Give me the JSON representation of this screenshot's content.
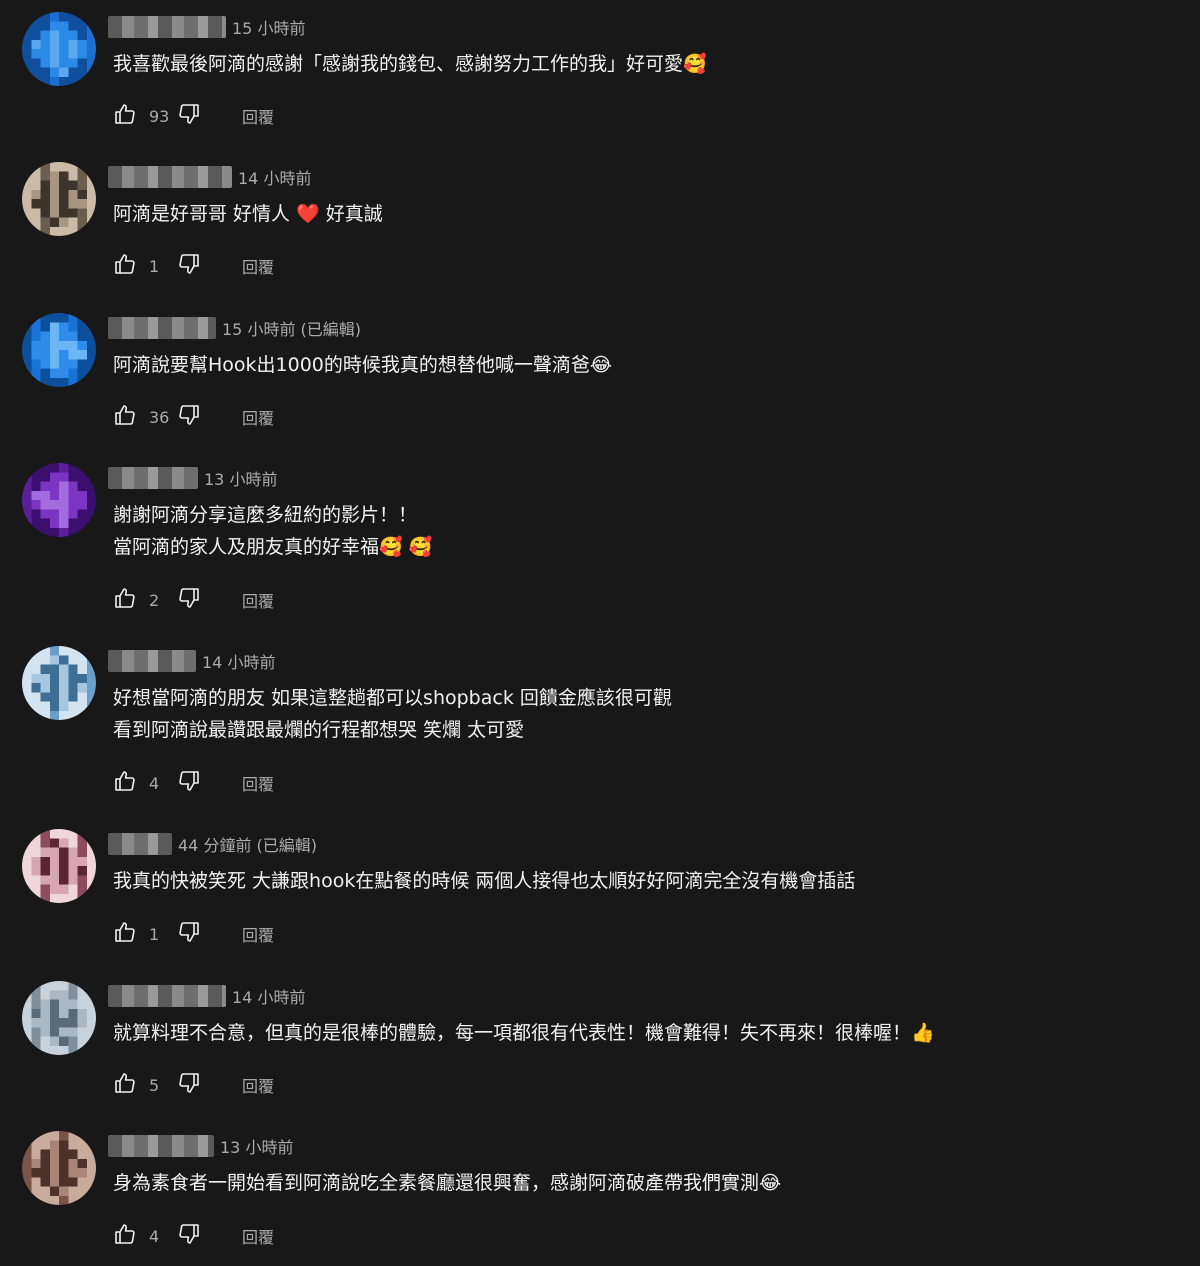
{
  "ui": {
    "reply_label": "回覆"
  },
  "comments": [
    {
      "time": "15 小時前",
      "text_lines": [
        "我喜歡最後阿滴的感謝「感謝我的錢包、感謝努力工作的我」好可愛🥰"
      ],
      "likes": "93",
      "avatar_colors": [
        "#1a6fd1",
        "#2b8ae6",
        "#5aa8f0",
        "#0f4f9e"
      ]
    },
    {
      "time": "14 小時前",
      "text_lines": [
        "阿滴是好哥哥 好情人 ❤️ 好真誠"
      ],
      "likes": "1",
      "avatar_colors": [
        "#6b5e4e",
        "#a89680",
        "#3d342c",
        "#cbbba6"
      ]
    },
    {
      "time": "15 小時前 (已編輯)",
      "text_lines": [
        "阿滴說要幫Hook出1000的時候我真的想替他喊一聲滴爸😂"
      ],
      "likes": "36",
      "avatar_colors": [
        "#1773d6",
        "#2f8cea",
        "#6cb6f5",
        "#0c4f9a"
      ]
    },
    {
      "time": "13 小時前",
      "text_lines": [
        "謝謝阿滴分享這麼多紐約的影片！！",
        "當阿滴的家人及朋友真的好幸福🥰 🥰"
      ],
      "likes": "2",
      "avatar_colors": [
        "#5b1f9c",
        "#7a35c2",
        "#a36be0",
        "#3a0f6e"
      ]
    },
    {
      "time": "14 小時前",
      "text_lines": [
        "好想當阿滴的朋友 如果這整趟都可以shopback 回饋金應該很可觀",
        "看到阿滴說最讚跟最爛的行程都想哭 笑爛 太可愛"
      ],
      "likes": "4",
      "avatar_colors": [
        "#6a9fc9",
        "#a7c7e0",
        "#3d6f96",
        "#d3e3ef"
      ]
    },
    {
      "time": "44 分鐘前 (已編輯)",
      "text_lines": [
        "我真的快被笑死 大謙跟hook在點餐的時候 兩個人接得也太順好好阿滴完全沒有機會插話"
      ],
      "likes": "1",
      "avatar_colors": [
        "#8e4b5f",
        "#d6a6b4",
        "#5a2636",
        "#efd5dc"
      ]
    },
    {
      "time": "14 小時前",
      "text_lines": [
        "就算料理不合意，但真的是很棒的體驗，每一項都很有代表性！機會難得！失不再來！很棒喔！👍"
      ],
      "likes": "5",
      "avatar_colors": [
        "#7f8f9c",
        "#aab8c3",
        "#5b6a76",
        "#c8d2da"
      ]
    },
    {
      "time": "13 小時前",
      "text_lines": [
        "身為素食者一開始看到阿滴說吃全素餐廳還很興奮，感謝阿滴破產帶我們實測😂"
      ],
      "likes": "4",
      "avatar_colors": [
        "#7a5446",
        "#a88576",
        "#4d3229",
        "#c9ab9c"
      ]
    }
  ]
}
